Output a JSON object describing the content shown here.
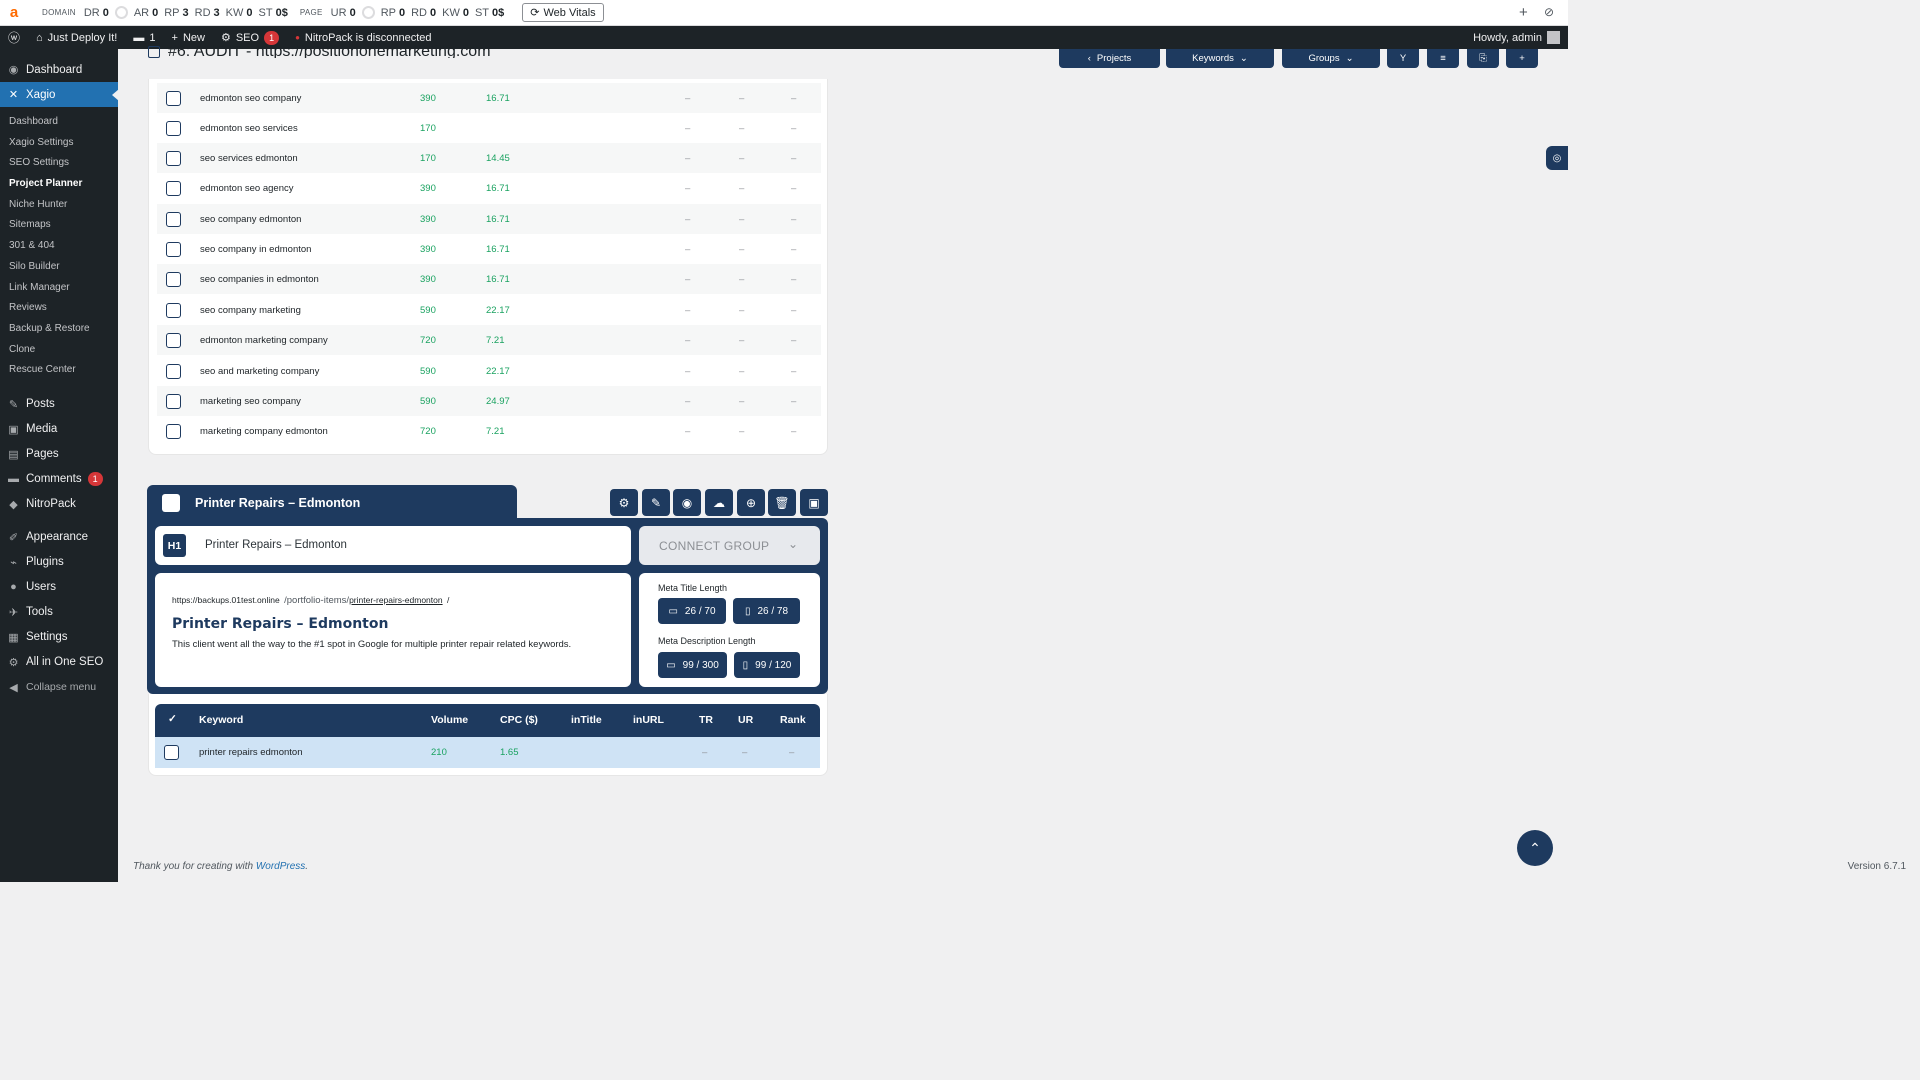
{
  "seo_bar": {
    "logo": "a",
    "domain_label": "DOMAIN",
    "domain_metrics": [
      {
        "name": "DR",
        "value": "0"
      },
      {
        "name": "AR",
        "value": "0"
      },
      {
        "name": "RP",
        "value": "3"
      },
      {
        "name": "RD",
        "value": "3"
      },
      {
        "name": "KW",
        "value": "0"
      },
      {
        "name": "ST",
        "value": "0$"
      }
    ],
    "page_label": "PAGE",
    "page_metrics": [
      {
        "name": "UR",
        "value": "0"
      },
      {
        "name": "RP",
        "value": "0"
      },
      {
        "name": "RD",
        "value": "0"
      },
      {
        "name": "KW",
        "value": "0"
      },
      {
        "name": "ST",
        "value": "0$"
      }
    ],
    "web_vitals_label": "Web Vitals"
  },
  "admin_bar": {
    "site_name": "Just Deploy It!",
    "comments_count": "1",
    "new_label": "New",
    "seo_label": "SEO",
    "seo_badge": "1",
    "nitropack_status": "NitroPack is disconnected",
    "howdy": "Howdy, admin"
  },
  "sidebar": {
    "dashboard": "Dashboard",
    "xagio": "Xagio",
    "xagio_submenu": [
      "Dashboard",
      "Xagio Settings",
      "SEO Settings",
      "Project Planner",
      "Niche Hunter",
      "Sitemaps",
      "301 & 404",
      "Silo Builder",
      "Link Manager",
      "Reviews",
      "Backup & Restore",
      "Clone",
      "Rescue Center"
    ],
    "posts": "Posts",
    "media": "Media",
    "pages": "Pages",
    "comments": "Comments",
    "comments_badge": "1",
    "nitropack": "NitroPack",
    "appearance": "Appearance",
    "plugins": "Plugins",
    "users": "Users",
    "tools": "Tools",
    "settings": "Settings",
    "aioseo": "All in One SEO",
    "collapse": "Collapse menu"
  },
  "header": {
    "title": "#6: AUDIT - https://positiononemarketing.com",
    "projects_label": "Projects",
    "keywords_label": "Keywords",
    "groups_label": "Groups"
  },
  "keywords": [
    {
      "keyword": "edmonton seo company",
      "volume": "390",
      "cpc": "16.71"
    },
    {
      "keyword": "edmonton seo services",
      "volume": "170",
      "cpc": ""
    },
    {
      "keyword": "seo services edmonton",
      "volume": "170",
      "cpc": "14.45"
    },
    {
      "keyword": "edmonton seo agency",
      "volume": "390",
      "cpc": "16.71"
    },
    {
      "keyword": "seo company edmonton",
      "volume": "390",
      "cpc": "16.71"
    },
    {
      "keyword": "seo company in edmonton",
      "volume": "390",
      "cpc": "16.71"
    },
    {
      "keyword": "seo companies in edmonton",
      "volume": "390",
      "cpc": "16.71"
    },
    {
      "keyword": "seo company marketing",
      "volume": "590",
      "cpc": "22.17"
    },
    {
      "keyword": "edmonton marketing company",
      "volume": "720",
      "cpc": "7.21"
    },
    {
      "keyword": "seo and marketing company",
      "volume": "590",
      "cpc": "22.17"
    },
    {
      "keyword": "marketing seo company",
      "volume": "590",
      "cpc": "24.97"
    },
    {
      "keyword": "marketing company edmonton",
      "volume": "720",
      "cpc": "7.21"
    }
  ],
  "dash": "–",
  "group": {
    "name": "Printer Repairs – Edmonton",
    "h1_badge": "H1",
    "h1_value": "Printer Repairs – Edmonton",
    "connect_group": "CONNECT GROUP",
    "url_base": "https://backups.01test.online",
    "url_path": "/portfolio-items/",
    "url_slug": "printer-repairs-edmonton",
    "url_trailing": "/",
    "seo_title": "Printer Repairs – Edmonton",
    "seo_description": "This client went all the way to the #1 spot in Google for multiple printer repair related keywords.",
    "meta_title_label": "Meta Title Length",
    "meta_title_desktop": "26 / 70",
    "meta_title_mobile": "26 / 78",
    "meta_desc_label": "Meta Description Length",
    "meta_desc_desktop": "99 / 300",
    "meta_desc_mobile": "99 / 120"
  },
  "group_table": {
    "headers": [
      "Keyword",
      "Volume",
      "CPC ($)",
      "inTitle",
      "inURL",
      "TR",
      "UR",
      "Rank"
    ],
    "rows": [
      {
        "keyword": "printer repairs edmonton",
        "volume": "210",
        "cpc": "1.65"
      }
    ]
  },
  "footer": {
    "thanks": "Thank you for creating with",
    "wp_link": "WordPress",
    "version": "Version 6.7.1"
  },
  "colors": {
    "accent": "#1e3a5f",
    "wp_blue": "#2271b1",
    "green": "#1aa260"
  }
}
